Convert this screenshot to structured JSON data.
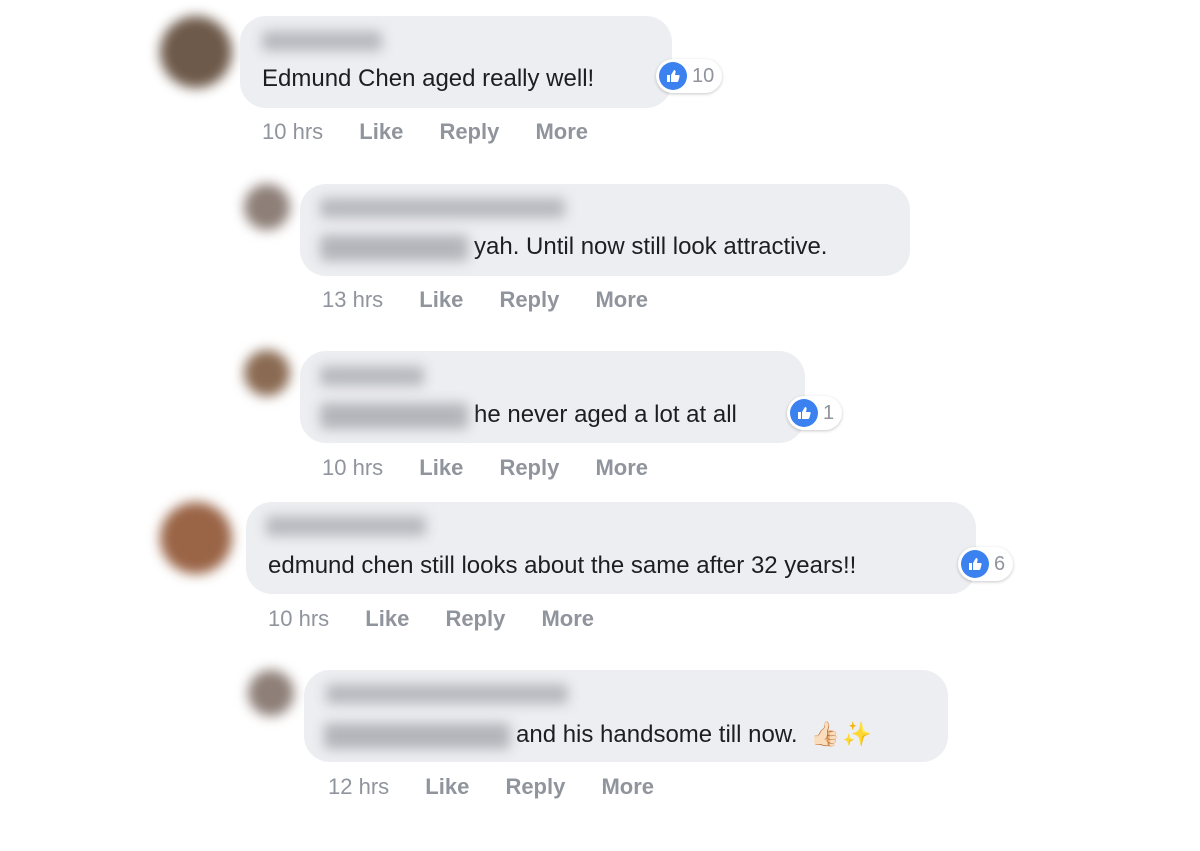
{
  "comments": [
    {
      "id": "c1",
      "avatar_color": "#6e5a4a",
      "name_blurred": true,
      "text": "Edmund Chen aged really well!",
      "reaction_count": "10",
      "time": "10 hrs",
      "actions": [
        "Like",
        "Reply",
        "More"
      ]
    },
    {
      "id": "c2",
      "avatar_color": "#8e7f78",
      "name_blurred": true,
      "tag_blurred": true,
      "text": "yah. Until now still look attractive.",
      "time": "13 hrs",
      "actions": [
        "Like",
        "Reply",
        "More"
      ]
    },
    {
      "id": "c3",
      "avatar_color": "#8a6a52",
      "name_blurred": true,
      "tag_blurred": true,
      "text": "he never aged a lot at all",
      "reaction_count": "1",
      "time": "10 hrs",
      "actions": [
        "Like",
        "Reply",
        "More"
      ]
    },
    {
      "id": "c4",
      "avatar_color": "#9a6446",
      "name_blurred": true,
      "text": "edmund chen still looks about the same after 32 years!!",
      "reaction_count": "6",
      "time": "10 hrs",
      "actions": [
        "Like",
        "Reply",
        "More"
      ]
    },
    {
      "id": "c5",
      "avatar_color": "#8e7f78",
      "name_blurred": true,
      "tag_blurred": true,
      "text": "and his handsome till now.",
      "emojis": [
        "👍🏻",
        "✨"
      ],
      "time": "12 hrs",
      "actions": [
        "Like",
        "Reply",
        "More"
      ]
    }
  ],
  "reaction_icon": "thumbs-up-icon",
  "colors": {
    "bubble": "#edeef1",
    "like_blue": "#3b82f0",
    "meta_gray": "#90949c"
  }
}
